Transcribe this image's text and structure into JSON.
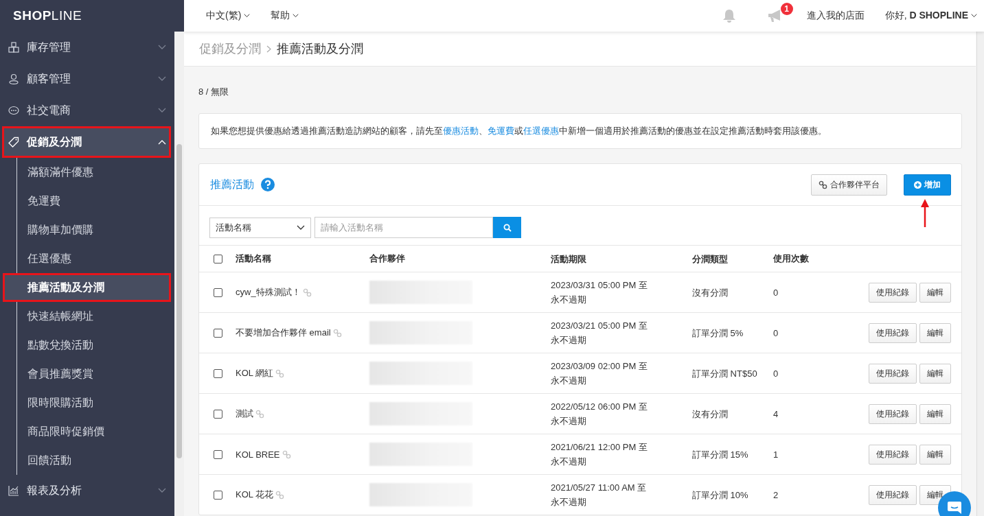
{
  "logo": "**SHOP**LINE",
  "topbar": {
    "menus": [
      {
        "label": "中文(繁)"
      },
      {
        "label": "幫助"
      }
    ],
    "notification_count": "1",
    "store_link": "進入我的店面",
    "greeting": "你好, **D SHOPLINE**"
  },
  "sidebar": {
    "items": [
      {
        "label": "庫存管理",
        "expanded": false,
        "highlighted": false
      },
      {
        "label": "顧客管理",
        "expanded": false,
        "highlighted": false
      },
      {
        "label": "社交電商",
        "expanded": false,
        "highlighted": false
      },
      {
        "label": "促銷及分潤",
        "expanded": true,
        "highlighted": true,
        "children": [
          {
            "label": "滿額滿件優惠",
            "selected": false,
            "highlighted": false
          },
          {
            "label": "免運費",
            "selected": false,
            "highlighted": false
          },
          {
            "label": "購物車加價購",
            "selected": false,
            "highlighted": false
          },
          {
            "label": "任選優惠",
            "selected": false,
            "highlighted": false
          },
          {
            "label": "推薦活動及分潤",
            "selected": true,
            "highlighted": true
          },
          {
            "label": "快速結帳網址",
            "selected": false,
            "highlighted": false
          },
          {
            "label": "點數兌換活動",
            "selected": false,
            "highlighted": false
          },
          {
            "label": "會員推薦獎賞",
            "selected": false,
            "highlighted": false
          },
          {
            "label": "限時限購活動",
            "selected": false,
            "highlighted": false
          },
          {
            "label": "商品限時促銷價",
            "selected": false,
            "highlighted": false
          },
          {
            "label": "回饋活動",
            "selected": false,
            "highlighted": false
          }
        ]
      },
      {
        "label": "報表及分析",
        "expanded": false,
        "highlighted": false
      }
    ]
  },
  "breadcrumb": [
    "促銷及分潤",
    "推薦活動及分潤"
  ],
  "quota": "8 / 無限",
  "info": [
    {
      "kind": "text",
      "text": "如果您想提供優惠給透過推薦活動造訪網站的顧客，請先至"
    },
    {
      "kind": "link",
      "text": "優惠活動"
    },
    {
      "kind": "text",
      "text": "、"
    },
    {
      "kind": "link",
      "text": "免運費"
    },
    {
      "kind": "text",
      "text": "或"
    },
    {
      "kind": "link",
      "text": "任選優惠"
    },
    {
      "kind": "text",
      "text": "中新增一個適用於推薦活動的優惠並在設定推薦活動時套用該優惠。"
    }
  ],
  "card": {
    "title": "推薦活動",
    "partner_button": "合作夥伴平台",
    "add_button": "增加",
    "add_button_arrow": true,
    "filter": {
      "field": "活動名稱",
      "placeholder": "請輸入活動名稱"
    },
    "table": {
      "columns": [
        "活動名稱",
        "合作夥伴",
        "活動期限",
        "分潤類型",
        "使用次數"
      ],
      "header_checked": false,
      "rows": [
        {
          "checked": false,
          "name": "cyw_特殊測試！",
          "period_start": "2023/03/31 05:00 PM 至",
          "period_end": "永不過期",
          "share_type": "沒有分潤",
          "uses": "0",
          "actions": [
            "使用紀錄",
            "編輯"
          ]
        },
        {
          "checked": false,
          "name": "不要增加合作夥伴 email",
          "period_start": "2023/03/21 05:00 PM 至",
          "period_end": "永不過期",
          "share_type": "訂單分潤 5%",
          "uses": "0",
          "actions": [
            "使用紀錄",
            "編輯"
          ]
        },
        {
          "checked": false,
          "name": "KOL 網紅",
          "period_start": "2023/03/09 02:00 PM 至",
          "period_end": "永不過期",
          "share_type": "訂單分潤 NT$50",
          "uses": "0",
          "actions": [
            "使用紀錄",
            "編輯"
          ]
        },
        {
          "checked": false,
          "name": "測試",
          "period_start": "2022/05/12 06:00 PM 至",
          "period_end": "永不過期",
          "share_type": "沒有分潤",
          "uses": "4",
          "actions": [
            "使用紀錄",
            "編輯"
          ]
        },
        {
          "checked": false,
          "name": "KOL BREE",
          "period_start": "2021/06/21 12:00 PM 至",
          "period_end": "永不過期",
          "share_type": "訂單分潤 15%",
          "uses": "1",
          "actions": [
            "使用紀錄",
            "編輯"
          ]
        },
        {
          "checked": false,
          "name": "KOL 花花",
          "period_start": "2021/05/27 11:00 AM 至",
          "period_end": "永不過期",
          "share_type": "訂單分潤 10%",
          "uses": "2",
          "actions": [
            "使用紀錄",
            "編輯"
          ]
        }
      ]
    }
  }
}
